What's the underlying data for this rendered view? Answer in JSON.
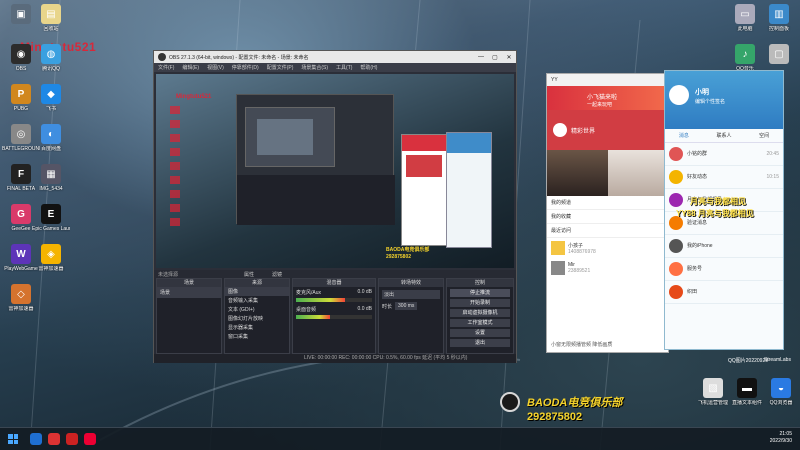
{
  "desktop": {
    "watermark": "Mingtutu521",
    "icons": [
      {
        "label": "",
        "color": "#5a6b7c",
        "glyph": "▣"
      },
      {
        "label": "回收站",
        "color": "#e8d58b",
        "glyph": "▤"
      },
      {
        "label": "OBS",
        "color": "#2c2c2c",
        "glyph": "◉"
      },
      {
        "label": "腾讯QQ",
        "color": "#3aa0e0",
        "glyph": "◍"
      },
      {
        "label": "PUBG",
        "color": "#d1871e",
        "glyph": "P"
      },
      {
        "label": "飞书",
        "color": "#1e88e5",
        "glyph": "◆"
      },
      {
        "label": "BATTLEGROUNDS",
        "color": "#888",
        "glyph": "◎"
      },
      {
        "label": "百度网盘",
        "color": "#3f8ee0",
        "glyph": "◐"
      },
      {
        "label": "FINAL BETA",
        "color": "#222",
        "glyph": "F"
      },
      {
        "label": "IMG_5434",
        "color": "#556",
        "glyph": "▦"
      },
      {
        "label": "GeeGee",
        "color": "#d93a6a",
        "glyph": "G"
      },
      {
        "label": "Epic Games Launcher",
        "color": "#111",
        "glyph": "E"
      },
      {
        "label": "PlayWebGame",
        "color": "#5d34b8",
        "glyph": "W"
      },
      {
        "label": "雷神加速器",
        "color": "#f5b400",
        "glyph": "◈"
      },
      {
        "label": "雷神加速器",
        "color": "#d5732e",
        "glyph": "◇"
      }
    ],
    "right_icons": [
      {
        "label": "此电脑",
        "color": "#aab",
        "glyph": "▭"
      },
      {
        "label": "控制面板",
        "color": "#3b89c9",
        "glyph": "▥"
      },
      {
        "label": "QQ音乐",
        "color": "#35a56a",
        "glyph": "♪"
      },
      {
        "label": "",
        "color": "#bbb",
        "glyph": "▢"
      }
    ],
    "bottom_right": [
      {
        "label": "飞机运营管理",
        "color": "#ddd",
        "glyph": "▧"
      },
      {
        "label": "直播文本组件",
        "color": "#111",
        "glyph": "▬"
      },
      {
        "label": "QQ浏览器",
        "color": "#2a7ae2",
        "glyph": "◒"
      }
    ],
    "other_labels": [
      {
        "name": "qq-desktop-label",
        "text": "QQ图片20220929"
      },
      {
        "name": "stream-desktop-label",
        "text": "StreamLabs"
      }
    ]
  },
  "obs": {
    "title": "OBS 27.1.3 (64-bit, windows) - 配置文件: 未命名 - 场景: 未命名",
    "menu": [
      "文件(F)",
      "编辑(E)",
      "视图(V)",
      "停靠部件(D)",
      "配置文件(P)",
      "场景集合(S)",
      "工具(T)",
      "帮助(H)"
    ],
    "preview_overlay_title": "Mingtutu521",
    "preview_brand_name": "BAODA电竞俱乐部",
    "preview_brand_num": "292875802",
    "no_source": "未选择源",
    "props": "属性",
    "filters": "滤镜",
    "panels": {
      "scenes": {
        "title": "场景",
        "items": [
          "场景"
        ]
      },
      "sources": {
        "title": "来源",
        "items": [
          "图像",
          "音频输入采集",
          "文本 (GDI+)",
          "图像幻灯片放映",
          "显示器采集",
          "窗口采集"
        ]
      },
      "mixer": {
        "title": "混音器",
        "channels": [
          {
            "name": "麦克风/Aux",
            "db": "0.0 dB",
            "level_fraction": 0.65
          },
          {
            "name": "桌面音频",
            "db": "0.0 dB",
            "level_fraction": 0.45
          }
        ]
      },
      "transitions": {
        "title": "转场特效",
        "type": "淡出",
        "duration_label": "时长",
        "duration": "300 ms"
      },
      "controls": {
        "title": "控制",
        "buttons": [
          "停止推流",
          "开始录制",
          "启动虚拟摄像机",
          "工作室模式",
          "设置",
          "退出"
        ]
      }
    },
    "status": "LIVE: 00:00:00    REC: 00:00:00    CPU: 0.5%, 60.00 fps    延迟 (平均 5 秒以内)"
  },
  "yy": {
    "title": "YY",
    "username": "小飞猫来啦",
    "subtitle": "一起来玩吧",
    "hero": "精彩世界",
    "list": [
      {
        "label": "我的频道"
      },
      {
        "label": "我的收藏"
      },
      {
        "label": "最近访问"
      }
    ],
    "channel1": {
      "name": "小孩子",
      "id": "1408876978"
    },
    "channel2": {
      "name": "Mir",
      "id": "23889521"
    },
    "footer": "小窗无限频播管频   降低画质"
  },
  "qq": {
    "name": "小明",
    "status": "编辑个性签名",
    "tabs": [
      "消息",
      "联系人",
      "空间"
    ],
    "items": [
      {
        "title": "小铭的群",
        "sub": "",
        "time": "20:45",
        "color": "#e05555"
      },
      {
        "title": "好友动态",
        "sub": "",
        "time": "10:15",
        "color": "#f4b400"
      },
      {
        "title": "月亮与我都相见",
        "sub": "",
        "time": "",
        "color": "#9c27b0"
      },
      {
        "title": "验证消息",
        "sub": "",
        "time": "",
        "color": "#f57c00"
      },
      {
        "title": "我的iPhone",
        "sub": "",
        "time": "",
        "color": "#555"
      },
      {
        "title": "服务号",
        "sub": "",
        "time": "",
        "color": "#ff7043"
      },
      {
        "title": "织田",
        "sub": "",
        "time": "",
        "color": "#e64a19"
      }
    ],
    "banner1": "月亮与我都相见",
    "banner2": "YY88 月亮与我都相见"
  },
  "brand": {
    "name": "BAODA电竞俱乐部",
    "number": "292875802"
  },
  "taskbar": {
    "time": "21:05",
    "date": "2022/9/30",
    "icons": [
      "#1f6fd1",
      "#d33",
      "#c22",
      "#e03"
    ]
  }
}
